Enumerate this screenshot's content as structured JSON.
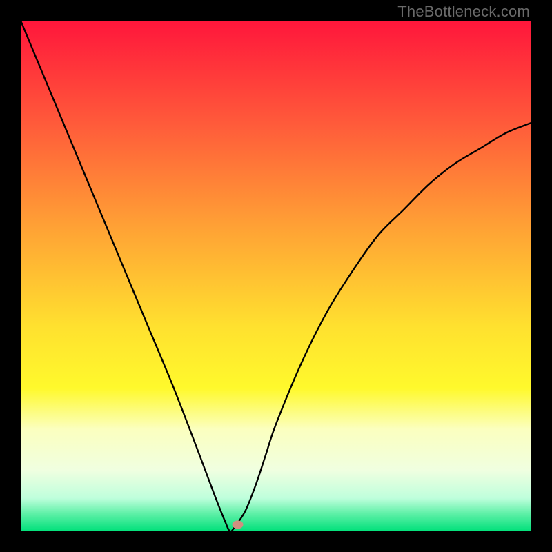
{
  "watermark": "TheBottleneck.com",
  "chart_data": {
    "type": "line",
    "title": "",
    "xlabel": "",
    "ylabel": "",
    "xlim": [
      0,
      100
    ],
    "ylim": [
      0,
      100
    ],
    "optimum_x": 41,
    "marker": {
      "x": 42.5,
      "y": 1.3,
      "color": "#cf8f80"
    },
    "gradient_stops": [
      {
        "offset": 0.0,
        "color": "#ff163b"
      },
      {
        "offset": 0.2,
        "color": "#ff5a3a"
      },
      {
        "offset": 0.4,
        "color": "#ffa035"
      },
      {
        "offset": 0.6,
        "color": "#ffe12f"
      },
      {
        "offset": 0.72,
        "color": "#fff92c"
      },
      {
        "offset": 0.8,
        "color": "#fbffbf"
      },
      {
        "offset": 0.88,
        "color": "#f0ffe0"
      },
      {
        "offset": 0.935,
        "color": "#bfffdc"
      },
      {
        "offset": 0.965,
        "color": "#60f0a8"
      },
      {
        "offset": 1.0,
        "color": "#00e07a"
      }
    ],
    "series": [
      {
        "name": "bottleneck-curve",
        "x": [
          0,
          5,
          10,
          15,
          20,
          25,
          30,
          35,
          38,
          40,
          41,
          42,
          44,
          46,
          48,
          50,
          55,
          60,
          65,
          70,
          75,
          80,
          85,
          90,
          95,
          100
        ],
        "values": [
          100,
          88,
          76,
          64,
          52,
          40,
          28,
          15,
          7,
          2,
          0,
          1,
          4,
          9,
          15,
          21,
          33,
          43,
          51,
          58,
          63,
          68,
          72,
          75,
          78,
          80
        ]
      }
    ]
  }
}
